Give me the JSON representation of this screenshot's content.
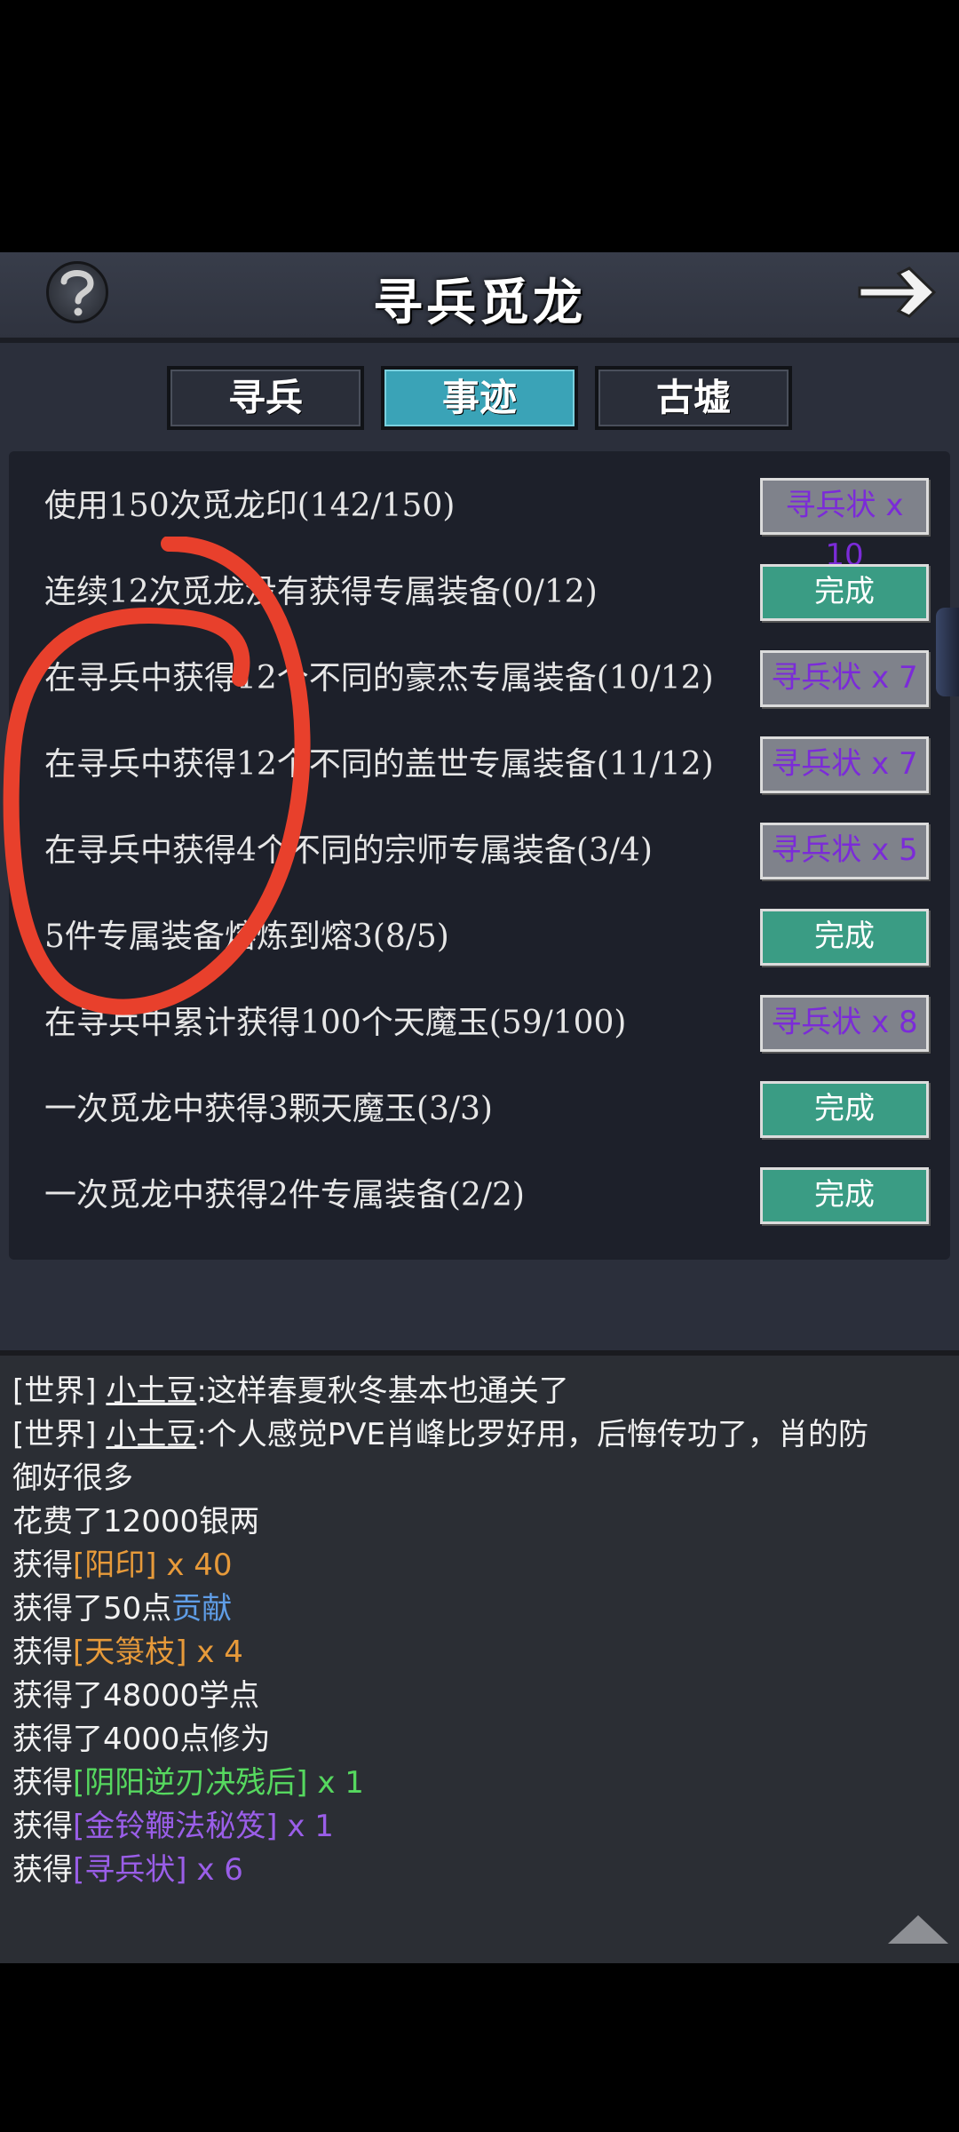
{
  "header": {
    "title": "寻兵觅龙",
    "help_icon": "question-icon",
    "back_icon": "arrow-right-icon"
  },
  "tabs": [
    {
      "label": "寻兵",
      "active": false
    },
    {
      "label": "事迹",
      "active": true
    },
    {
      "label": "古墟",
      "active": false
    }
  ],
  "tasks": [
    {
      "text": "使用150次觅龙印(142/150)",
      "button": "寻兵状 x 10",
      "state": "reward"
    },
    {
      "text": "连续12次觅龙没有获得专属装备(0/12)",
      "button": "完成",
      "state": "done"
    },
    {
      "text": "在寻兵中获得12个不同的豪杰专属装备(10/12)",
      "button": "寻兵状 x 7",
      "state": "reward"
    },
    {
      "text": "在寻兵中获得12个不同的盖世专属装备(11/12)",
      "button": "寻兵状 x 7",
      "state": "reward"
    },
    {
      "text": "在寻兵中获得4个不同的宗师专属装备(3/4)",
      "button": "寻兵状 x 5",
      "state": "reward"
    },
    {
      "text": "5件专属装备熔炼到熔3(8/5)",
      "button": "完成",
      "state": "done"
    },
    {
      "text": "在寻兵中累计获得100个天魔玉(59/100)",
      "button": "寻兵状 x 8",
      "state": "reward"
    },
    {
      "text": "一次觅龙中获得3颗天魔玉(3/3)",
      "button": "完成",
      "state": "done"
    },
    {
      "text": "一次觅龙中获得2件专属装备(2/2)",
      "button": "完成",
      "state": "done"
    }
  ],
  "chat": {
    "lines": [
      {
        "prefix": "[世界]",
        "name": "小土豆",
        "text": ":这样春夏秋冬基本也通关了"
      },
      {
        "prefix": "[世界]",
        "name": "小土豆",
        "text": ":个人感觉PVE肖峰比罗好用，后悔传功了，肖的防"
      },
      {
        "text": "御好很多"
      },
      {
        "text": "花费了12000银两"
      },
      {
        "text": "获得",
        "item": "[阳印]",
        "qty": " x 40",
        "color": "orange"
      },
      {
        "text": "获得了50点",
        "item": "贡献",
        "color": "blue"
      },
      {
        "text": "获得",
        "item": "[天箓枝]",
        "qty": " x 4",
        "color": "orange"
      },
      {
        "text": "获得了48000学点"
      },
      {
        "text": "获得了4000点修为"
      },
      {
        "text": "获得",
        "item": "[阴阳逆刃决残后]",
        "qty": " x 1",
        "color": "green"
      },
      {
        "text": "获得",
        "item": "[金铃鞭法秘笈]",
        "qty": " x 1",
        "color": "purple"
      },
      {
        "text": "获得",
        "item": "[寻兵状]",
        "qty": " x 6",
        "color": "purple"
      }
    ]
  },
  "colors": {
    "active_tab": "#3aa3b7",
    "done_button": "#3a9c84",
    "reward_text": "#7b2bd8"
  }
}
